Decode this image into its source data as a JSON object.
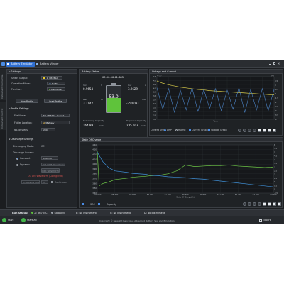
{
  "header": {
    "tabs": [
      {
        "label": "Battery Emulator",
        "active": true
      },
      {
        "label": "Battery Viewer",
        "active": false
      }
    ]
  },
  "sidebar": {
    "items": [
      {
        "label": "Instrument Connection"
      },
      {
        "label": "Instrument Control"
      }
    ]
  },
  "settings": {
    "title": "Settings",
    "select_output_label": "Select Output:",
    "select_output_value": "1: N6781A",
    "operation_mode_label": "Operation Mode:",
    "operation_mode_value": "Profile",
    "function_label": "Function:",
    "function_value": "Discharge",
    "new_profile_label": "New Profile",
    "load_profile_label": "Load Profile",
    "profile_settings_title": "Profile Settings",
    "file_name_label": "File Name:",
    "file_name_value": "5V_PRE4XX_Output",
    "folder_location_label": "Folder Location:",
    "folder_location_value": "\\Battery",
    "no_of_steps_label": "No. of steps:",
    "no_of_steps_value": "200",
    "discharge_settings_title": "Discharge Settings",
    "discharging_mode_label": "Discharging Mode:",
    "discharging_mode_value": "CC",
    "discharge_current_label": "Discharge Current:",
    "constant_label": "Constant",
    "constant_value": "250 mA",
    "dynamic_label": "Dynamic",
    "dynamic_value": "C3 (ARB Waveform)",
    "edit_waveform_label": "Edit Waveform",
    "waveform_configured_text": "Arb Waveform (Configured)",
    "frequency_count_label": "Frequency Count",
    "frequency_count_value": "1",
    "continuous_label": "Continuous"
  },
  "battery_status": {
    "title": "Battery Status",
    "elapsed_time": "00:00:56:41:885",
    "percent": "53.0",
    "level_fraction": 0.53,
    "vol_label": "Vol",
    "vol_value": "0.9654",
    "cur_label": "Cur",
    "cur_value": "3.2629",
    "pwr_label": "Pwr",
    "pwr_value": "3.2142",
    "pwr_right_value": "-250.031",
    "remaining_capacity_label": "Remaining Capacity",
    "remaining_capacity_value": "264.997",
    "depleted_capacity_label": "Depleted Capacity",
    "depleted_capacity_value": "235.003",
    "unit_v": "V",
    "unit_a": "A",
    "unit_w": "W",
    "unit_mah": "mAh",
    "unit_ma": "mA"
  },
  "vc_panel": {
    "title": "Voltage and Current",
    "x_axis_label": "Time",
    "left_axis_label": "V (V)",
    "right_axis_label": "I(A)",
    "current_unit_label": "Current Unit:",
    "amp_label": "AMP",
    "mamp_label": "mAmp",
    "current_graph_label": "Current Graph",
    "voltage_graph_label": "Voltage Graph"
  },
  "soc_panel": {
    "title": "State Of Charge",
    "x_axis_label": "State Of Charge(%)",
    "legend_soc": "SOC",
    "legend_capacity": "Capacity"
  },
  "status_bar": {
    "run_status_label": "Run Status:",
    "items": [
      {
        "label": "A: N6705C",
        "state": "Stopped"
      },
      {
        "label": "B: No Instrument"
      },
      {
        "label": "C: No Instrument"
      },
      {
        "label": "D: No Instrument"
      }
    ],
    "start_label": "Start",
    "start_all_label": "Start All",
    "copyright": "Copyright © Keysight BenchVue Advanced Battery Test and Emulation",
    "export_label": "Export"
  },
  "colors": {
    "accent": "#2f6fd1",
    "battery_fill": "#5fc33b",
    "voltage_trace": "#d9cc4a",
    "current_trace": "#4d86c9",
    "soc_trace": "#6fc948",
    "capacity_trace": "#3f8fd6",
    "start_green": "#43b649"
  },
  "chart_data": [
    {
      "type": "line",
      "title": "Voltage and Current",
      "xlabel": "Time",
      "ylabel": "V (V)",
      "y2label": "I(A)",
      "ylim": [
        3.2,
        4.3
      ],
      "y2lim": [
        -4,
        1
      ],
      "y_ticks": [
        4.3,
        4.2,
        4.1,
        4.0,
        3.9,
        3.8,
        3.7,
        3.6,
        3.5,
        3.4,
        3.3,
        3.2
      ],
      "y2_ticks": [
        1,
        0.5,
        0,
        -0.5,
        -1,
        -1.5,
        -2,
        -2.5,
        -3,
        -3.5,
        -4
      ],
      "x": [
        0,
        5,
        10,
        15,
        20,
        25,
        30,
        35,
        40,
        45,
        50,
        55,
        60,
        65,
        70,
        75,
        80,
        85,
        90,
        95,
        100
      ],
      "series": [
        {
          "name": "Voltage Graph",
          "values": [
            4.19,
            4.13,
            4.09,
            4.06,
            4.03,
            4.01,
            3.99,
            3.97,
            3.96,
            3.94,
            3.93,
            3.92,
            3.91,
            3.9,
            3.89,
            3.88,
            3.87,
            3.86,
            3.85,
            3.84,
            3.83
          ]
        },
        {
          "name": "Current Graph",
          "values": [
            -0.3,
            -2.8,
            -0.4,
            -3.2,
            -0.6,
            -2.9,
            -0.3,
            -3.1,
            -0.5,
            -2.7,
            -0.4,
            -3.0,
            -0.6,
            -2.8,
            -0.3,
            -3.2,
            -0.5,
            -2.9,
            -0.4,
            -3.0,
            -0.5
          ]
        }
      ]
    },
    {
      "type": "line",
      "title": "State Of Charge",
      "xlabel": "State Of Charge(%)",
      "ylabel": "",
      "y2label": "",
      "ylim": [
        3.4,
        4.4
      ],
      "y2lim": [
        -0.5,
        6
      ],
      "x_ticks": [
        "100.000",
        "95.300",
        "90.600",
        "85.900",
        "81.200",
        "76.500",
        "71.800",
        "67.100",
        "62.400",
        "57.700",
        "53.000"
      ],
      "y_ticks": [
        4.4,
        4.3,
        4.2,
        4.1,
        4.0,
        3.9,
        3.8,
        3.7,
        3.6,
        3.5,
        3.4
      ],
      "y2_ticks": [
        6,
        5.5,
        5,
        4.5,
        4,
        3.5,
        3,
        2.5,
        2,
        1.5,
        1,
        0.5,
        0,
        -0.5
      ],
      "x": [
        100.0,
        99.5,
        98.5,
        97.0,
        95.3,
        92.0,
        90.6,
        87.0,
        85.9,
        83.5,
        81.2,
        78.8,
        76.5,
        74.0,
        71.8,
        69.5,
        67.1,
        64.8,
        62.4,
        60.0,
        57.7,
        55.3,
        53.0
      ],
      "series": [
        {
          "name": "SOC",
          "values": [
            4.28,
            3.55,
            3.6,
            3.63,
            3.68,
            3.71,
            3.73,
            3.75,
            3.76,
            3.77,
            3.8,
            3.86,
            3.98,
            3.95,
            3.96,
            3.97,
            3.97,
            3.98,
            3.96,
            3.95,
            3.94,
            3.93,
            3.94
          ]
        },
        {
          "name": "Capacity",
          "values": [
            4.25,
            4.18,
            4.05,
            3.93,
            3.86,
            3.83,
            3.81,
            3.79,
            3.77,
            3.76,
            3.74,
            3.73,
            3.72,
            3.7,
            3.69,
            3.67,
            3.65,
            3.63,
            3.61,
            3.59,
            3.57,
            3.55,
            3.53
          ]
        }
      ]
    }
  ]
}
